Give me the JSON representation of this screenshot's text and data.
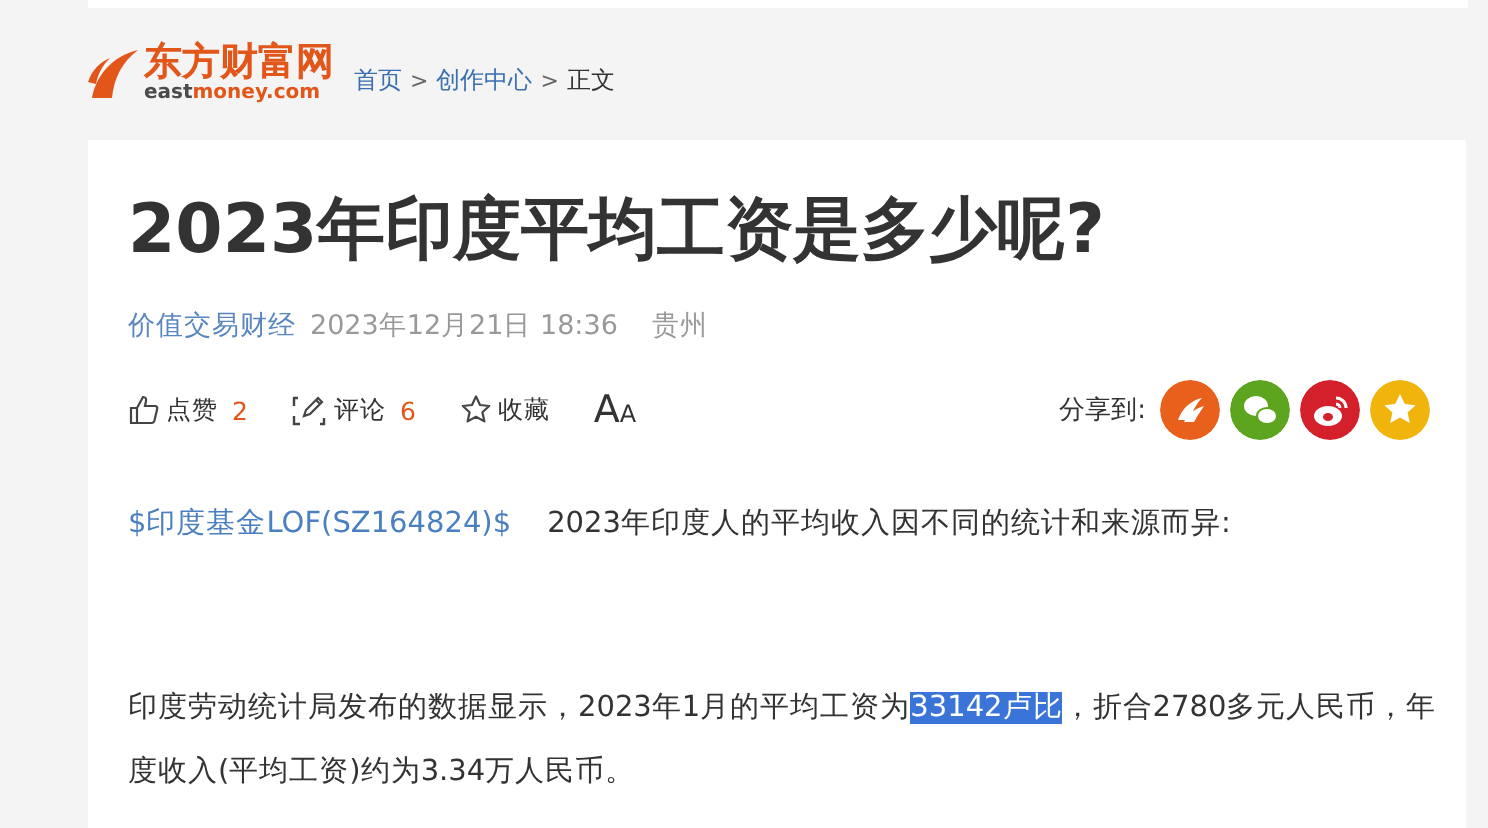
{
  "logo": {
    "name": "东方财富网",
    "domain_dark": "east",
    "domain_accent": "money.com"
  },
  "breadcrumb": {
    "separator": ">",
    "items": [
      {
        "label": "首页",
        "link": true
      },
      {
        "label": "创作中心",
        "link": true
      },
      {
        "label": "正文",
        "link": false
      }
    ]
  },
  "article": {
    "title": "2023年印度平均工资是多少呢?",
    "author": "价值交易财经",
    "date": "2023年12月21日 18:36",
    "location": "贵州",
    "actions": [
      {
        "kind": "like",
        "label": "点赞",
        "count": "2"
      },
      {
        "kind": "comment",
        "label": "评论",
        "count": "6"
      },
      {
        "kind": "favorite",
        "label": "收藏"
      },
      {
        "kind": "fontsize",
        "large": "A",
        "small": "A"
      }
    ],
    "share": {
      "label": "分享到:",
      "targets": [
        {
          "kind": "eastmoney",
          "color": "#e8601c"
        },
        {
          "kind": "wechat",
          "color": "#5ea51f"
        },
        {
          "kind": "weibo",
          "color": "#d4202a"
        },
        {
          "kind": "qzone",
          "color": "#f0b40c"
        }
      ]
    },
    "paragraphs": [
      {
        "tag": "$印度基金LOF(SZ164824)$",
        "segments": [
          {
            "text": "2023年印度人的平均收入因不同的统计和来源而异:",
            "selected": false
          }
        ]
      },
      {
        "segments": [
          {
            "text": "印度劳动统计局发布的数据显示，2023年1月的平均工资为",
            "selected": false
          },
          {
            "text": "33142卢比",
            "selected": true
          },
          {
            "text": "，折合2780多元人民币，年度收入(平均工资)约为3.34万人民币。",
            "selected": false
          }
        ]
      }
    ]
  }
}
